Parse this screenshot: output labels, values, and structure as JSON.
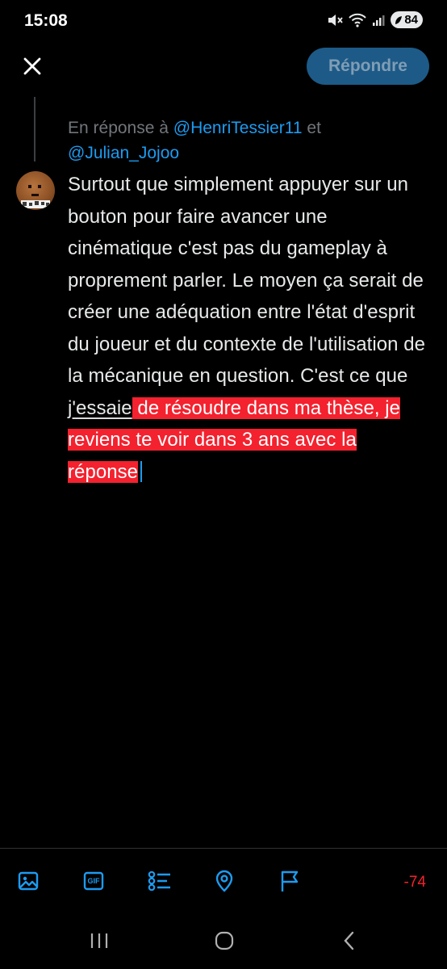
{
  "status_bar": {
    "time": "15:08",
    "battery_level": "84",
    "icons": [
      "mute-icon",
      "wifi-icon",
      "signal-icon",
      "battery-icon"
    ]
  },
  "header": {
    "close_icon": "close-icon",
    "reply_button_label": "Répondre"
  },
  "reply_context": {
    "prefix": "En réponse à ",
    "mention_1": "@HenriTessier11",
    "conjunction": " et",
    "mention_2": "@Julian_Jojoo"
  },
  "compose": {
    "text_before": "Surtout que simplement appuyer sur un bouton pour faire avancer une cinématique c'est pas du gameplay à proprement parler. Le moyen ça serait de créer une adéquation entre l'état d'esprit du joueur et du contexte de l'utilisation de la mécanique en question. C'est ce que ",
    "spellcheck_word": "j'essaie",
    "overflow_text": " de résoudre dans ma thèse, je reviens te voir dans 3 ans avec la réponse"
  },
  "toolbar": {
    "icons": [
      "image-icon",
      "gif-icon",
      "poll-icon",
      "location-icon",
      "flag-icon"
    ],
    "gif_label": "GIF",
    "char_count": "-74"
  },
  "colors": {
    "accent": "#1d9bf0",
    "error": "#f4212e",
    "background": "#000000",
    "text": "#e7e9ea",
    "muted": "#71767b",
    "button_disabled": "#1d5a87"
  }
}
